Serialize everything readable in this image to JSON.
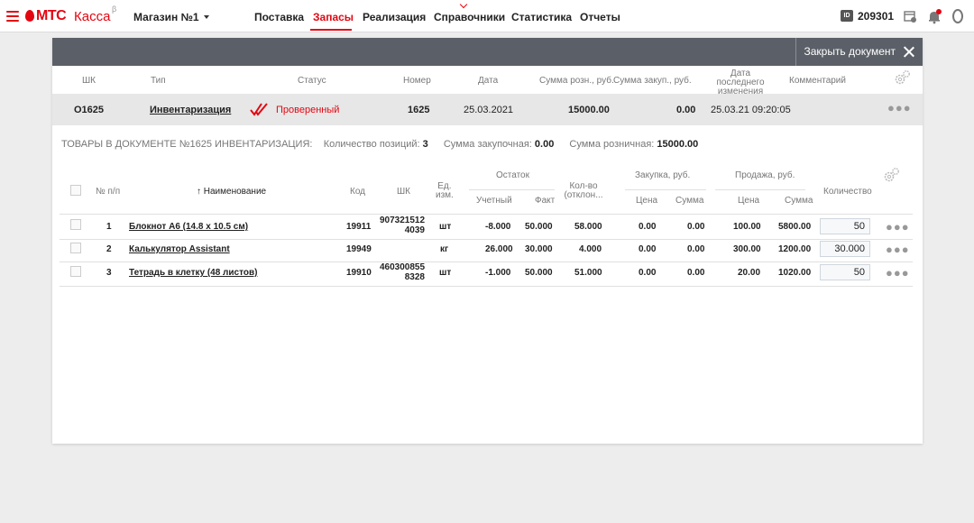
{
  "brand": {
    "mts": "МТС",
    "kassa": "Касса",
    "beta": "β"
  },
  "store": {
    "name": "Магазин №1"
  },
  "nav": {
    "items": [
      {
        "label": "Поставка"
      },
      {
        "label": "Запасы"
      },
      {
        "label": "Реализация"
      },
      {
        "label": "Справочники"
      },
      {
        "label": "Статистика"
      },
      {
        "label": "Отчеты"
      }
    ],
    "active": "Запасы"
  },
  "user": {
    "id_badge": "ID",
    "id": "209301"
  },
  "icons": {
    "menu": "hamburger-icon",
    "store_dropdown": "chevron-down-icon",
    "top": [
      "calendar-icon",
      "bell-icon",
      "user-icon"
    ],
    "close": "close-icon",
    "settings": "gear-icon",
    "verified": "double-check-icon",
    "row_menu": "more-icon"
  },
  "colors": {
    "brand_red": "#e30611",
    "header_gray": "#5b6068",
    "row_gray": "#e7e7e7",
    "background": "#ededed"
  },
  "panel": {
    "close_label": "Закрыть документ"
  },
  "doc_table": {
    "headers": {
      "barcode": "ШК",
      "type": "Тип",
      "status": "Статус",
      "number": "Номер",
      "date": "Дата",
      "sum_retail": "Сумма розн., руб.",
      "sum_purchase": "Сумма закуп., руб.",
      "last_changed_1": "Дата последнего",
      "last_changed_2": "изменения",
      "comment": "Комментарий"
    },
    "row": {
      "barcode": "O1625",
      "type": "Инвентаризация",
      "status": "Проверенный",
      "number": "1625",
      "date": "25.03.2021",
      "sum_retail": "15000.00",
      "sum_purchase": "0.00",
      "last_changed": "25.03.21 09:20:05",
      "comment": ""
    }
  },
  "summary": {
    "title": "ТОВАРЫ В ДОКУМЕНТЕ №1625 ИНВЕНТАРИЗАЦИЯ:",
    "positions_label": "Количество позиций:",
    "positions_value": "3",
    "purchase_label": "Сумма закупочная:",
    "purchase_value": "0.00",
    "retail_label": "Сумма розничная:",
    "retail_value": "15000.00"
  },
  "goods_table": {
    "headers": {
      "num": "№ п/п",
      "name": "↑ Наименование",
      "code": "Код",
      "barcode": "ШК",
      "unit_1": "Ед.",
      "unit_2": "изм.",
      "stock": "Остаток",
      "stock_accounting": "Учетный",
      "stock_fact": "Факт",
      "deviation_1": "Кол-во",
      "deviation_2": "(отклон...",
      "purchase": "Закупка, руб.",
      "purchase_price": "Цена",
      "purchase_sum": "Сумма",
      "sale": "Продажа, руб.",
      "sale_price": "Цена",
      "sale_sum": "Сумма",
      "quantity": "Количество"
    },
    "rows": [
      {
        "num": "1",
        "name": "Блокнот А6 (14.8 x 10.5 см)",
        "code": "19911",
        "barcode_1": "907321512",
        "barcode_2": "4039",
        "unit": "шт",
        "accounting": "-8.000",
        "fact": "50.000",
        "deviation": "58.000",
        "purchase_price": "0.00",
        "purchase_sum": "0.00",
        "sale_price": "100.00",
        "sale_sum": "5800.00",
        "quantity": "50"
      },
      {
        "num": "2",
        "name": "Калькулятор Assistant",
        "code": "19949",
        "barcode_1": "",
        "barcode_2": "",
        "unit": "кг",
        "accounting": "26.000",
        "fact": "30.000",
        "deviation": "4.000",
        "purchase_price": "0.00",
        "purchase_sum": "0.00",
        "sale_price": "300.00",
        "sale_sum": "1200.00",
        "quantity": "30.000"
      },
      {
        "num": "3",
        "name": "Тетрадь в клетку (48 листов)",
        "code": "19910",
        "barcode_1": "460300855",
        "barcode_2": "8328",
        "unit": "шт",
        "accounting": "-1.000",
        "fact": "50.000",
        "deviation": "51.000",
        "purchase_price": "0.00",
        "purchase_sum": "0.00",
        "sale_price": "20.00",
        "sale_sum": "1020.00",
        "quantity": "50"
      }
    ]
  }
}
